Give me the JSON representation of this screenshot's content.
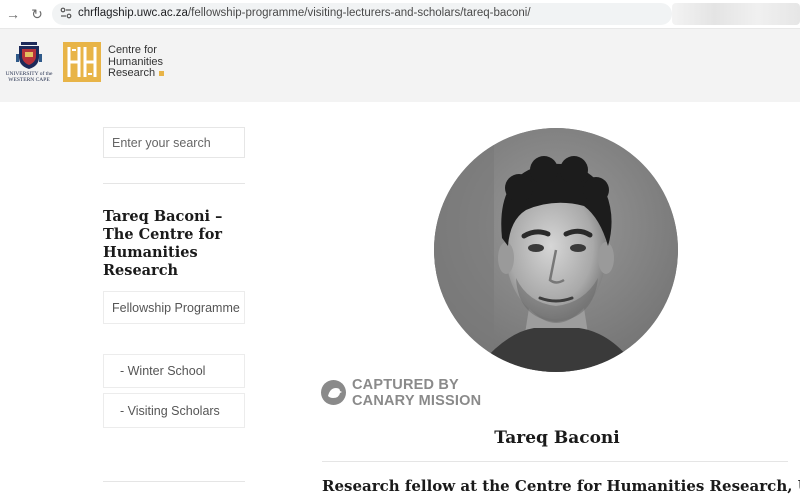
{
  "browser": {
    "back_icon": "arrow-right-icon",
    "reload_icon": "reload-icon",
    "site_info_icon": "site-settings-icon",
    "url_host": "chrflagship.uwc.ac.za",
    "url_path": "/fellowship-programme/visiting-lecturers-and-scholars/tareq-baconi/"
  },
  "header": {
    "uwc_logo_text": "UNIVERSITY of the WESTERN CAPE",
    "centre_title_line1": "Centre for",
    "centre_title_line2": "Humanities",
    "centre_title_line3": "Research",
    "accent_color": "#e8b447"
  },
  "sidebar": {
    "search_placeholder": "Enter your search",
    "page_heading": "Tareq Baconi – The Centre for Humanities Research",
    "nav": [
      {
        "label": "Fellowship Programme"
      },
      {
        "label": "- Winter School"
      },
      {
        "label": "- Visiting Scholars"
      }
    ]
  },
  "main": {
    "portrait_alt": "Tareq Baconi",
    "watermark_line1": "CAPTURED BY",
    "watermark_line2": "CANARY MISSION",
    "person_name": "Tareq Baconi",
    "subtitle": "Research fellow at the Centre for Humanities Research, UWC"
  }
}
